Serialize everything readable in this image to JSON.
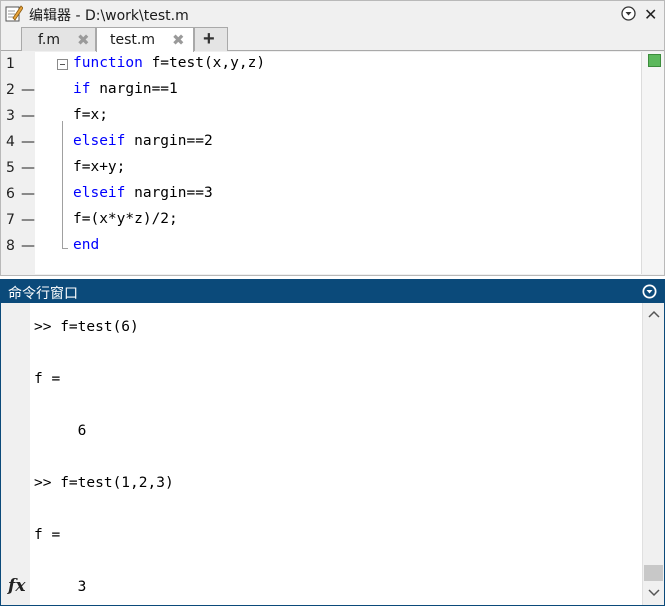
{
  "editor": {
    "title": "编辑器 - D:\\work\\test.m",
    "tabs": [
      {
        "label": "f.m",
        "active": false
      },
      {
        "label": "test.m",
        "active": true
      }
    ],
    "add_tab_label": "+",
    "close_glyph": "✖",
    "window_close_glyph": "✕",
    "lines": [
      {
        "number": "1",
        "marker": "",
        "code": "function f=test(x,y,z)"
      },
      {
        "number": "2",
        "marker": "—",
        "code": "if nargin==1"
      },
      {
        "number": "3",
        "marker": "—",
        "code": "f=x;"
      },
      {
        "number": "4",
        "marker": "—",
        "code": "elseif nargin==2"
      },
      {
        "number": "5",
        "marker": "—",
        "code": "f=x+y;"
      },
      {
        "number": "6",
        "marker": "—",
        "code": "elseif nargin==3"
      },
      {
        "number": "7",
        "marker": "—",
        "code": "f=(x*y*z)/2;"
      },
      {
        "number": "8",
        "marker": "—",
        "code": "end"
      }
    ],
    "keyword_color": "#0000ff",
    "status_color": "#5cb85c"
  },
  "command_window": {
    "title": "命令行窗口",
    "header_color": "#0b4a7a",
    "output": [
      ">> f=test(6)",
      "",
      "f =",
      "",
      "     6",
      "",
      ">> f=test(1,2,3)",
      "",
      "f =",
      "",
      "     3"
    ],
    "fx_label": "fx"
  }
}
